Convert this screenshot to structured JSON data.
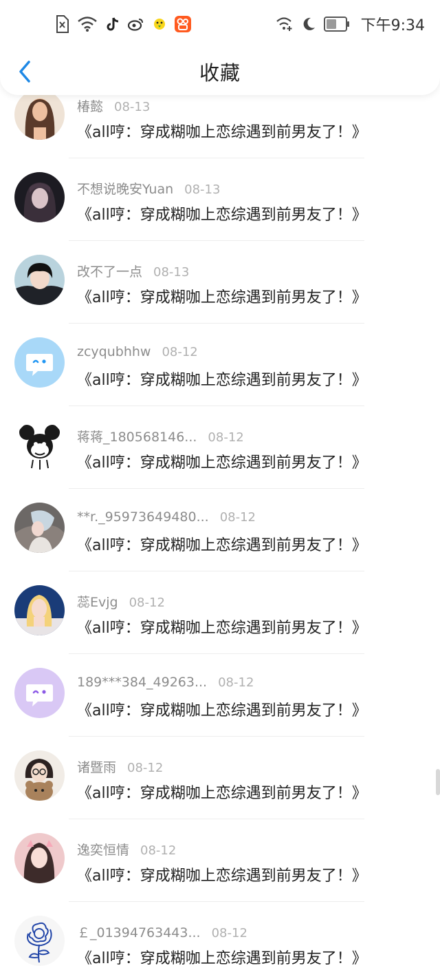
{
  "status_bar": {
    "time": "下午9:34",
    "left_icons": [
      "sim-x-icon",
      "wifi-icon",
      "tiktok-icon",
      "weibo-icon",
      "chick-app-icon",
      "kuaishou-icon"
    ],
    "right_icons": [
      "wifi-plus-icon",
      "moon-icon",
      "battery-icon"
    ]
  },
  "header": {
    "title": "收藏"
  },
  "colors": {
    "accent": "#1e88e5",
    "bubble_blue": "#2196f3",
    "bubble_purple": "#8c5ae6"
  },
  "items": [
    {
      "name": "椿懿",
      "date": "08-13",
      "content": "《all哼：穿成糊咖上恋综遇到前男友了！》",
      "avatar": "photo"
    },
    {
      "name": "不想说晚安Yuan",
      "date": "08-13",
      "content": "《all哼：穿成糊咖上恋综遇到前男友了！》",
      "avatar": "photo"
    },
    {
      "name": "改不了一点",
      "date": "08-13",
      "content": "《all哼：穿成糊咖上恋综遇到前男友了！》",
      "avatar": "photo"
    },
    {
      "name": "zcyqubhhw",
      "date": "08-12",
      "content": "《all哼：穿成糊咖上恋综遇到前男友了！》",
      "avatar": "default-blue"
    },
    {
      "name": "蒋蒋_180568146...",
      "date": "08-12",
      "content": "《all哼：穿成糊咖上恋综遇到前男友了！》",
      "avatar": "mouse-sketch"
    },
    {
      "name": "**r._95973649480...",
      "date": "08-12",
      "content": "《all哼：穿成糊咖上恋综遇到前男友了！》",
      "avatar": "photo"
    },
    {
      "name": "蕊Evjg",
      "date": "08-12",
      "content": "《all哼：穿成糊咖上恋综遇到前男友了！》",
      "avatar": "photo"
    },
    {
      "name": "189***384_49263...",
      "date": "08-12",
      "content": "《all哼：穿成糊咖上恋综遇到前男友了！》",
      "avatar": "default-purple"
    },
    {
      "name": "诸暨雨",
      "date": "08-12",
      "content": "《all哼：穿成糊咖上恋综遇到前男友了！》",
      "avatar": "photo"
    },
    {
      "name": "逸奕恒情",
      "date": "08-12",
      "content": "《all哼：穿成糊咖上恋综遇到前男友了！》",
      "avatar": "photo"
    },
    {
      "name": "￡_01394763443...",
      "date": "08-12",
      "content": "《all哼：穿成糊咖上恋综遇到前男友了！》",
      "avatar": "rose-sketch"
    }
  ]
}
